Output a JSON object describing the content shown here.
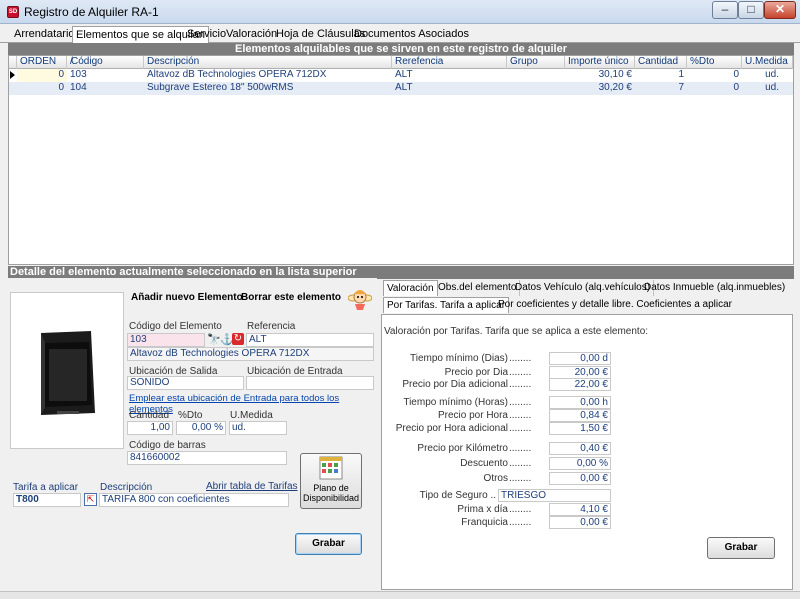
{
  "window": {
    "title": "Registro de Alquiler RA-1",
    "icon_text": "SD"
  },
  "tabs": [
    "Arrendatario",
    "Elementos que se alquilan",
    "Servicio",
    "Valoración",
    "Hoja de Cláusulas",
    "Documentos Asociados"
  ],
  "grid": {
    "header_title": "Elementos alquilables que se sirven en este registro de alquiler",
    "columns": [
      "ORDEN",
      "/",
      "Código",
      "Descripción",
      "Rerefencia",
      "Grupo",
      "Importe único",
      "Cantidad",
      "%Dto",
      "U.Medida"
    ],
    "rows": [
      {
        "orden": "0",
        "codigo": "103",
        "descripcion": "Altavoz dB Technologies OPERA 712DX",
        "referencia": "ALT",
        "grupo": "",
        "importe": "30,10 €",
        "cantidad": "1",
        "dto": "0",
        "umedida": "ud."
      },
      {
        "orden": "0",
        "codigo": "104",
        "descripcion": "Subgrave Estereo 18\" 500wRMS",
        "referencia": "ALT",
        "grupo": "",
        "importe": "30,20 €",
        "cantidad": "7",
        "dto": "0",
        "umedida": "ud."
      }
    ]
  },
  "detail": {
    "header_title": "Detalle del elemento actualmente seleccionado en la lista superior",
    "add_button": "Añadir nuevo Elemento",
    "delete_button": "Borrar este elemento",
    "codigo_label": "Código del Elemento",
    "codigo_value": "103",
    "referencia_label": "Referencia",
    "referencia_value": "ALT",
    "descripcion_value": "Altavoz dB Technologies OPERA 712DX",
    "ubic_salida_label": "Ubicación de Salida",
    "ubic_salida_value": "SONIDO",
    "ubic_entrada_label": "Ubicación de Entrada",
    "ubic_entrada_value": "",
    "emplear_link": "Emplear esta ubicación de Entrada para todos los elementos",
    "cantidad_label": "Cantidad",
    "cantidad_value": "1,00",
    "dto_label": "%Dto",
    "dto_value": "0,00 %",
    "umedida_label": "U.Medida",
    "umedida_value": "ud.",
    "barras_label": "Código de barras",
    "barras_value": "841660002",
    "tarifa_label": "Tarifa a aplicar",
    "tarifa_value": "T800",
    "desc_label": "Descripción",
    "abrir_link": "Abrir tabla de Tarifas",
    "tarifa_desc": "TARIFA 800 con coeficientes",
    "plano_button": "Plano de Disponibilidad",
    "grabar_button": "Grabar"
  },
  "right": {
    "tabs_top": [
      "Valoración",
      "Obs.del elemento",
      "Datos Vehículo (alq.vehículos)",
      "Datos Inmueble (alq.inmuebles)"
    ],
    "tabs_sub": [
      "Por Tarifas. Tarifa a aplicar",
      "Por coeficientes y detalle libre. Coeficientes a aplicar"
    ],
    "intro": "Valoración por Tarifas. Tarifa que se aplica a este elemento:",
    "fields": [
      {
        "label": "Tiempo mínimo (Dias)",
        "dots": "........",
        "value": "0,00 d"
      },
      {
        "label": "Precio por Dia",
        "dots": "........",
        "value": "20,00 €"
      },
      {
        "label": "Precio por Dia adicional",
        "dots": "........",
        "value": "22,00 €"
      },
      {
        "label": "Tiempo mínimo (Horas)",
        "dots": "........",
        "value": "0,00 h"
      },
      {
        "label": "Precio por Hora",
        "dots": "........",
        "value": "0,84 €"
      },
      {
        "label": "Precio por Hora adicional",
        "dots": "........",
        "value": "1,50 €"
      },
      {
        "label": "Precio por Kilómetro",
        "dots": "........",
        "value": "0,40 €"
      },
      {
        "label": "Descuento",
        "dots": "........",
        "value": "0,00 %"
      },
      {
        "label": "Otros",
        "dots": "........",
        "value": "0,00 €"
      }
    ],
    "seguro_label": "Tipo de Seguro ..",
    "seguro_value": "TRIESGO",
    "prima_label": "Prima x día",
    "prima_dots": "........",
    "prima_value": "4,10 €",
    "franquicia_label": "Franquicia",
    "franquicia_dots": "........",
    "franquicia_value": "0,00 €",
    "grabar_button": "Grabar"
  }
}
